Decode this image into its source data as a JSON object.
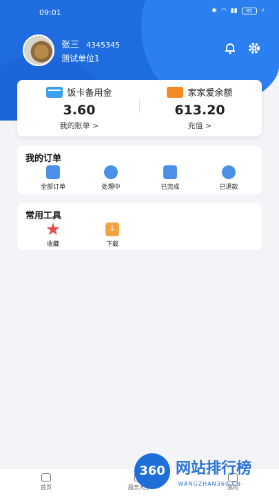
{
  "status_bar": {
    "time": "09:01",
    "battery": "85"
  },
  "profile": {
    "name": "张三",
    "id": "4345345",
    "org": "测试单位1"
  },
  "wallet": {
    "left": {
      "title": "饭卡备用金",
      "amount": "3.60",
      "link": "我的账单 >"
    },
    "right": {
      "title": "家家爱余额",
      "amount": "613.20",
      "link": "充值 >"
    }
  },
  "orders": {
    "title": "我的订单",
    "items": [
      {
        "label": "全部订单",
        "icon": "list-icon"
      },
      {
        "label": "处理中",
        "icon": "clock-icon"
      },
      {
        "label": "已完成",
        "icon": "check-doc-icon"
      },
      {
        "label": "已退款",
        "icon": "refund-icon"
      }
    ]
  },
  "tools": {
    "title": "常用工具",
    "items": [
      {
        "label": "收藏",
        "icon": "star-icon"
      },
      {
        "label": "下载",
        "icon": "download-icon"
      }
    ]
  },
  "tabbar": {
    "items": [
      {
        "label": "首页"
      },
      {
        "label": "服务大厅"
      },
      {
        "label": "我的"
      }
    ]
  },
  "watermark": {
    "logo": "360",
    "text": "网站排行榜",
    "sub": "-WANGZHAN360.CN-"
  },
  "colors": {
    "primary": "#1f6ce0",
    "accent_orange": "#f58a25",
    "star_red": "#ea4a4a"
  }
}
